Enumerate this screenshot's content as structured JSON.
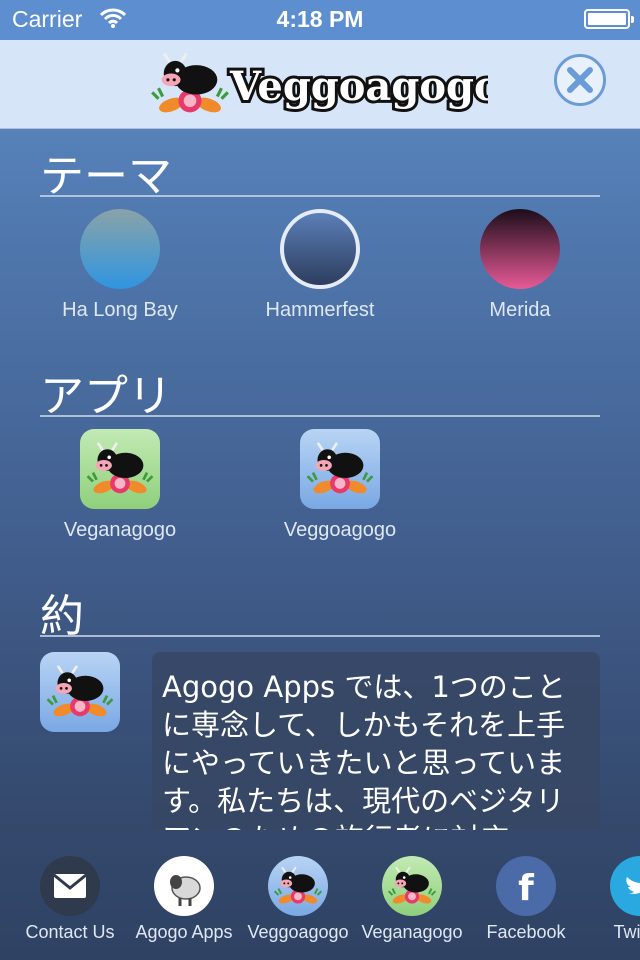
{
  "status_bar": {
    "carrier": "Carrier",
    "time": "4:18 PM"
  },
  "header": {
    "app_name": "Veggoagogo"
  },
  "sections": {
    "theme_title": "テーマ",
    "apps_title": "アプリ",
    "about_title": "約"
  },
  "themes": [
    {
      "label": "Ha Long Bay",
      "colors": [
        "#8aa3a8",
        "#2f95e0"
      ]
    },
    {
      "label": "Hammerfest",
      "colors": [
        "#5b7fb8",
        "#2d3d5e"
      ]
    },
    {
      "label": "Merida",
      "colors": [
        "#1b0d1a",
        "#e85a96"
      ]
    }
  ],
  "apps": [
    {
      "label": "Veganagogo",
      "bg": "#9dd98b"
    },
    {
      "label": "Veggoagogo",
      "bg": "#8fb7ea"
    }
  ],
  "about": {
    "text": "Agogo Apps では、1つのことに専念して、しかもそれを上手にやっていきたいと思っています。私たちは、現代のベジタリアンのための旅行者に対応"
  },
  "bottom_bar": [
    {
      "label": "Contact Us",
      "icon": "mail-icon"
    },
    {
      "label": "Agogo Apps",
      "icon": "sheep-icon"
    },
    {
      "label": "Veggoagogo",
      "icon": "cow-icon"
    },
    {
      "label": "Veganagogo",
      "icon": "cow-icon"
    },
    {
      "label": "Facebook",
      "icon": "facebook-icon"
    },
    {
      "label": "Twitter",
      "icon": "twitter-icon"
    }
  ]
}
